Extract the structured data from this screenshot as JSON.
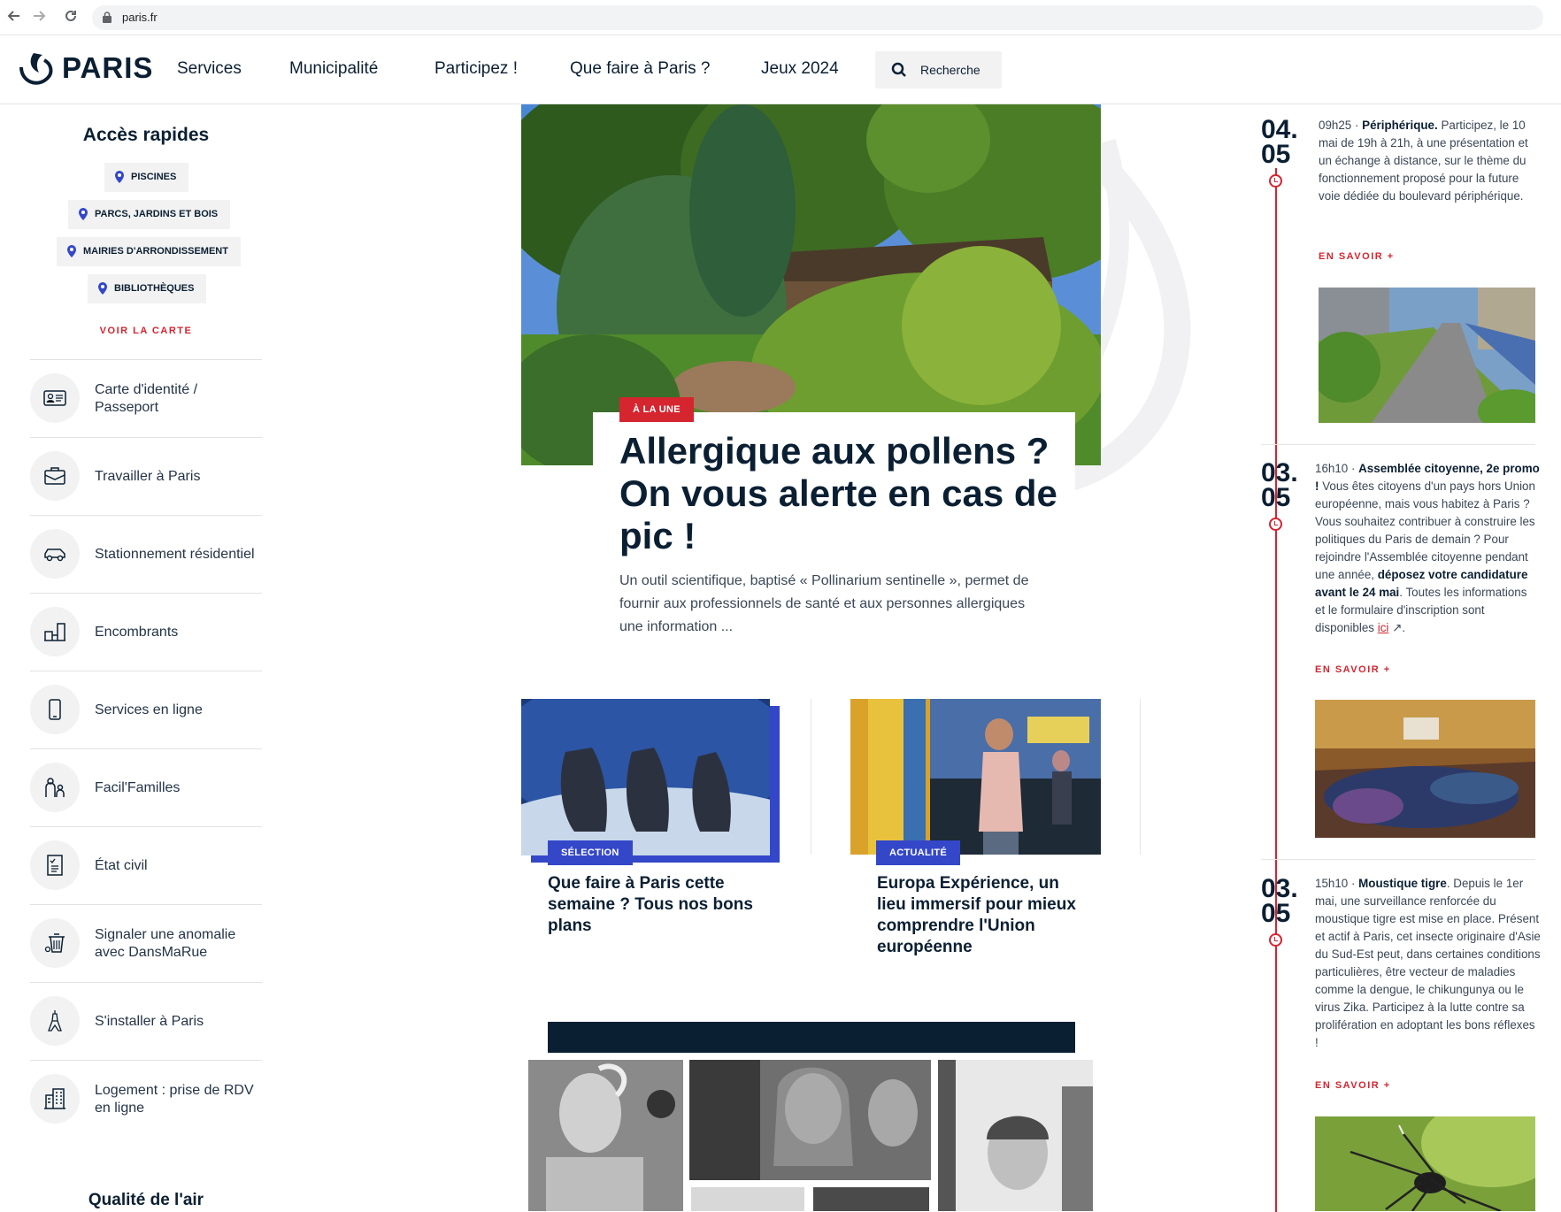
{
  "browser": {
    "url": "paris.fr",
    "back_icon": "arrow-left-icon",
    "forward_icon": "arrow-right-icon",
    "reload_icon": "reload-icon"
  },
  "header": {
    "logo_text": "PARIS",
    "nav": [
      "Services",
      "Municipalité",
      "Participez !",
      "Que faire à Paris ?",
      "Jeux 2024"
    ],
    "search_label": "Recherche"
  },
  "quick_access": {
    "title": "Accès rapides",
    "pills": [
      "PISCINES",
      "PARCS, JARDINS ET BOIS",
      "MAIRIES D'ARRONDISSEMENT",
      "BIBLIOTHÈQUES"
    ],
    "map_link": "VOIR LA CARTE"
  },
  "services": [
    {
      "label": "Carte d'identité / Passeport",
      "icon": "id-card-icon"
    },
    {
      "label": "Travailler à Paris",
      "icon": "briefcase-icon"
    },
    {
      "label": "Stationnement résidentiel",
      "icon": "car-icon"
    },
    {
      "label": "Encombrants",
      "icon": "furniture-icon"
    },
    {
      "label": "Services en ligne",
      "icon": "smartphone-icon"
    },
    {
      "label": "Facil'Familles",
      "icon": "family-icon"
    },
    {
      "label": "État civil",
      "icon": "document-icon"
    },
    {
      "label": "Signaler une anomalie avec DansMaRue",
      "icon": "trash-bin-icon"
    },
    {
      "label": "S'installer à Paris",
      "icon": "eiffel-tower-icon"
    },
    {
      "label": "Logement : prise de RDV en ligne",
      "icon": "building-icon"
    }
  ],
  "air_quality_title": "Qualité de l'air",
  "hero": {
    "tag": "À LA UNE",
    "title": "Allergique aux pollens ? On vous alerte en cas de pic !",
    "description": "Un outil scientifique, baptisé « Pollinarium sentinelle », permet de fournir aux professionnels de santé et aux personnes allergiques une information ..."
  },
  "cards": [
    {
      "tag": "SÉLECTION",
      "title": "Que faire à Paris cette semaine ? Tous nos bons plans"
    },
    {
      "tag": "ACTUALITÉ",
      "title": "Europa Expérience, un lieu immersif pour mieux comprendre l'Union européenne"
    }
  ],
  "timeline": [
    {
      "date_day": "04.",
      "date_month": "05",
      "time": "09h25 · ",
      "headline": "Périphérique.",
      "body": " Participez, le 10 mai de 19h à 21h, à une présentation et un échange à distance, sur le thème du fonctionnement proposé pour la future voie dédiée du boulevard périphérique.",
      "link": "EN SAVOIR +"
    },
    {
      "date_day": "03.",
      "date_month": "05",
      "time": "16h10 · ",
      "headline": "Assemblée citoyenne, 2e promo !",
      "body": " Vous êtes citoyens d'un pays hors Union européenne, mais vous habitez à Paris ? Vous souhaitez contribuer à construire les politiques du Paris de demain ? Pour rejoindre l'Assemblée citoyenne pendant une année, ",
      "emphasis": "déposez votre candidature avant le 24 mai",
      "body_end": ". Toutes les informations et le formulaire d'inscription sont disponibles ",
      "inline_link": "ici",
      "link": "EN SAVOIR +"
    },
    {
      "date_day": "03.",
      "date_month": "05",
      "time": "15h10 · ",
      "headline": "Moustique tigre",
      "body": ". Depuis le 1er mai, une surveillance renforcée du moustique tigre est mise en place. Présent et actif à Paris, cet insecte originaire d'Asie du Sud-Est peut, dans certaines conditions particulières, être vecteur de maladies comme la dengue, le chikungunya ou le virus Zika. Participez à la lutte contre sa prolifération en adoptant les bons réflexes !",
      "link": "EN SAVOIR +"
    }
  ],
  "colors": {
    "navy": "#0b1f33",
    "red": "#d5252f",
    "blue": "#3447c9",
    "grey_bg": "#f2f2f2"
  }
}
